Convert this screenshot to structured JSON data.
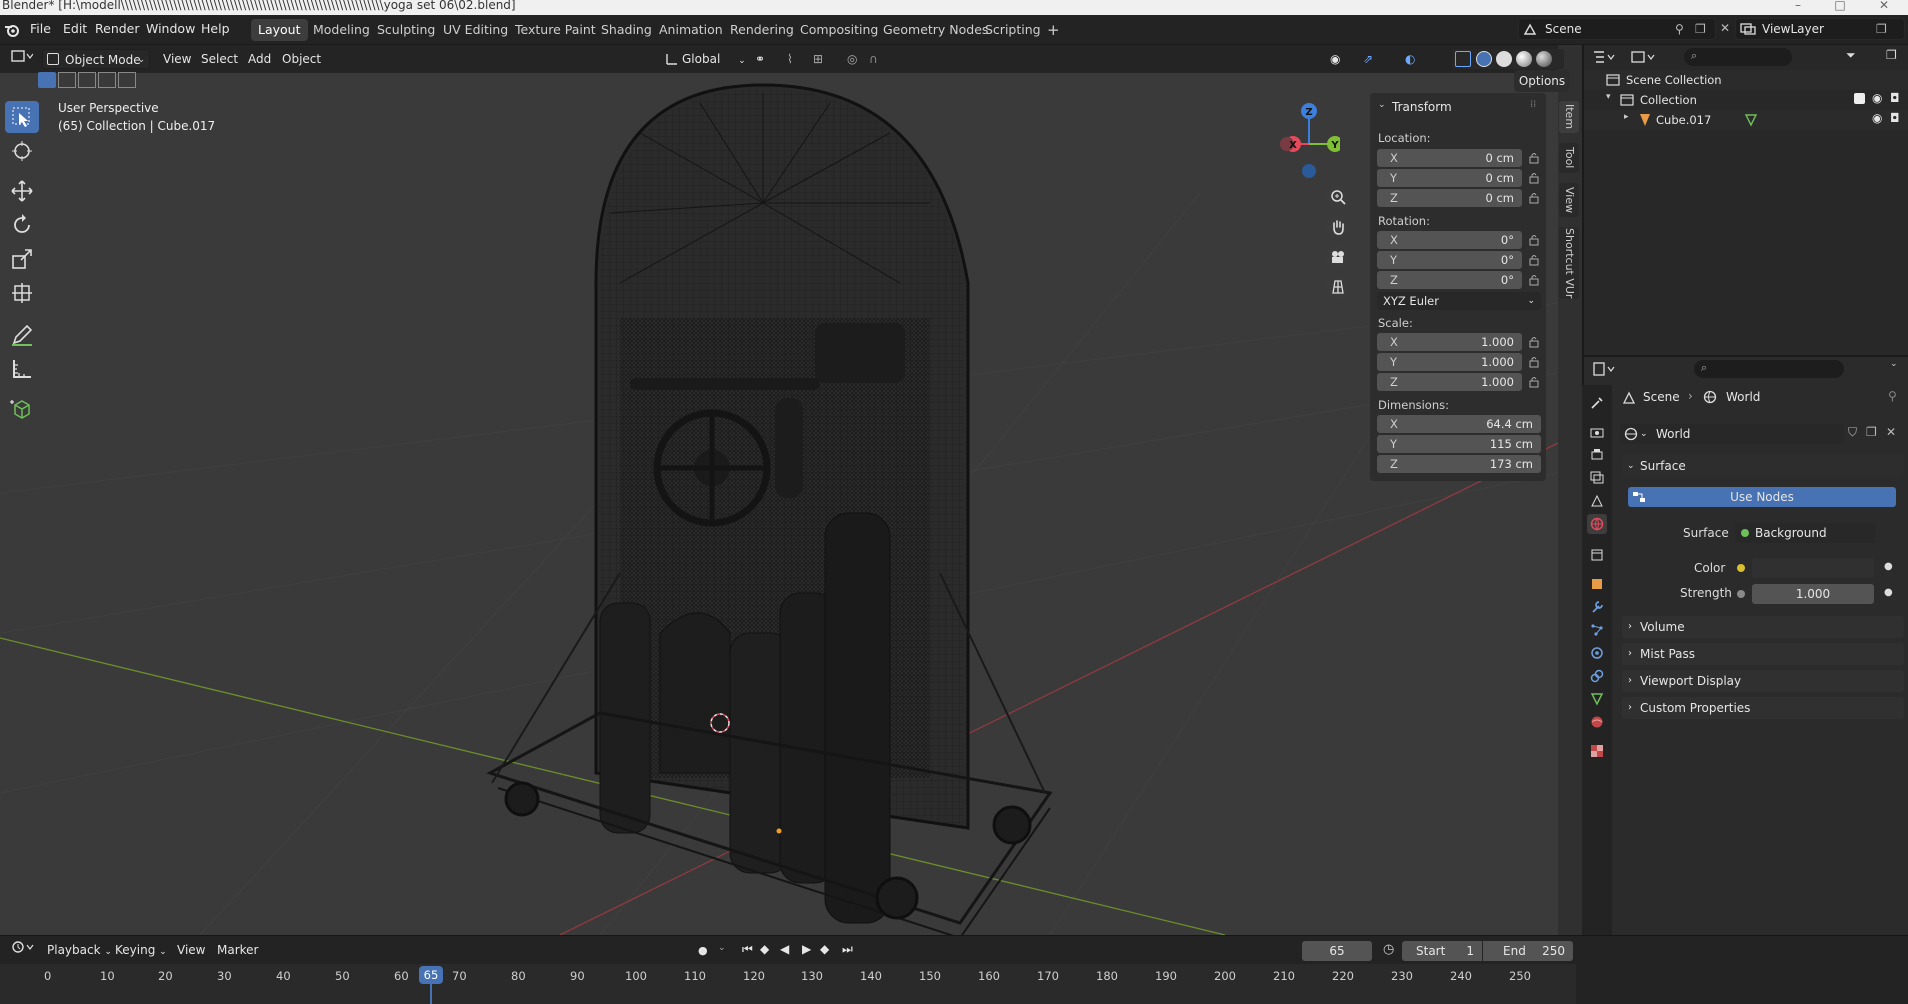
{
  "window": {
    "title": "Blender* [H:\\modell\\\\\\\\\\\\\\\\\\\\\\\\\\\\\\\\\\\\\\\\\\\\\\\\\\\\\\\\\\\\\\\\\\\\\\\\\\\\\\\\\\\\\\\\\\\\\\\\\\\\\\\\\\\\\\\\\\\\\\\\\\\\\\\\\\yoga set 06\\02.blend]"
  },
  "menu": [
    "File",
    "Edit",
    "Render",
    "Window",
    "Help"
  ],
  "workspaces": [
    "Layout",
    "Modeling",
    "Sculpting",
    "UV Editing",
    "Texture Paint",
    "Shading",
    "Animation",
    "Rendering",
    "Compositing",
    "Geometry Nodes",
    "Scripting"
  ],
  "workspace_add": "+",
  "scene_name": "Scene",
  "view_layer": "ViewLayer",
  "viewport_header": {
    "mode": "Object Mode",
    "menus": [
      "View",
      "Select",
      "Add",
      "Object"
    ],
    "transform_orientation": "Global",
    "options": "Options"
  },
  "viewport": {
    "perspective": "User Perspective",
    "collection_info": "(65) Collection | Cube.017",
    "gizmo": {
      "x": "X",
      "y": "Y",
      "z": "Z"
    }
  },
  "npanel": {
    "title": "Transform",
    "location_label": "Location:",
    "location": [
      {
        "axis": "X",
        "value": "0 cm"
      },
      {
        "axis": "Y",
        "value": "0 cm"
      },
      {
        "axis": "Z",
        "value": "0 cm"
      }
    ],
    "rotation_label": "Rotation:",
    "rotation": [
      {
        "axis": "X",
        "value": "0°"
      },
      {
        "axis": "Y",
        "value": "0°"
      },
      {
        "axis": "Z",
        "value": "0°"
      }
    ],
    "rotation_mode": "XYZ Euler",
    "scale_label": "Scale:",
    "scale": [
      {
        "axis": "X",
        "value": "1.000"
      },
      {
        "axis": "Y",
        "value": "1.000"
      },
      {
        "axis": "Z",
        "value": "1.000"
      }
    ],
    "dimensions_label": "Dimensions:",
    "dimensions": [
      {
        "axis": "X",
        "value": "64.4 cm"
      },
      {
        "axis": "Y",
        "value": "115 cm"
      },
      {
        "axis": "Z",
        "value": "173 cm"
      }
    ],
    "tabs": [
      "Item",
      "Tool",
      "View",
      "Shortcut VUr"
    ]
  },
  "outliner": {
    "scene_collection": "Scene Collection",
    "collection": "Collection",
    "object": "Cube.017"
  },
  "properties": {
    "breadcrumb_scene": "Scene",
    "breadcrumb_world": "World",
    "world_name": "World",
    "surface_panel": "Surface",
    "use_nodes": "Use Nodes",
    "surface_label": "Surface",
    "surface_value": "Background",
    "color_label": "Color",
    "strength_label": "Strength",
    "strength_value": "1.000",
    "sections": [
      "Volume",
      "Mist Pass",
      "Viewport Display",
      "Custom Properties"
    ]
  },
  "timeline": {
    "menus": [
      "Playback",
      "Keying",
      "View",
      "Marker"
    ],
    "current_frame": "65",
    "start_label": "Start",
    "start_value": "1",
    "end_label": "End",
    "end_value": "250",
    "ticks": [
      "0",
      "10",
      "20",
      "30",
      "40",
      "50",
      "60",
      "65",
      "70",
      "80",
      "90",
      "100",
      "110",
      "120",
      "130",
      "140",
      "150",
      "160",
      "170",
      "180",
      "190",
      "200",
      "210",
      "220",
      "230",
      "240",
      "250"
    ]
  },
  "colors": {
    "accent": "#4772b3",
    "x_axis": "#e44a5b",
    "y_axis": "#7fbf35",
    "z_axis": "#3d7fdc"
  }
}
